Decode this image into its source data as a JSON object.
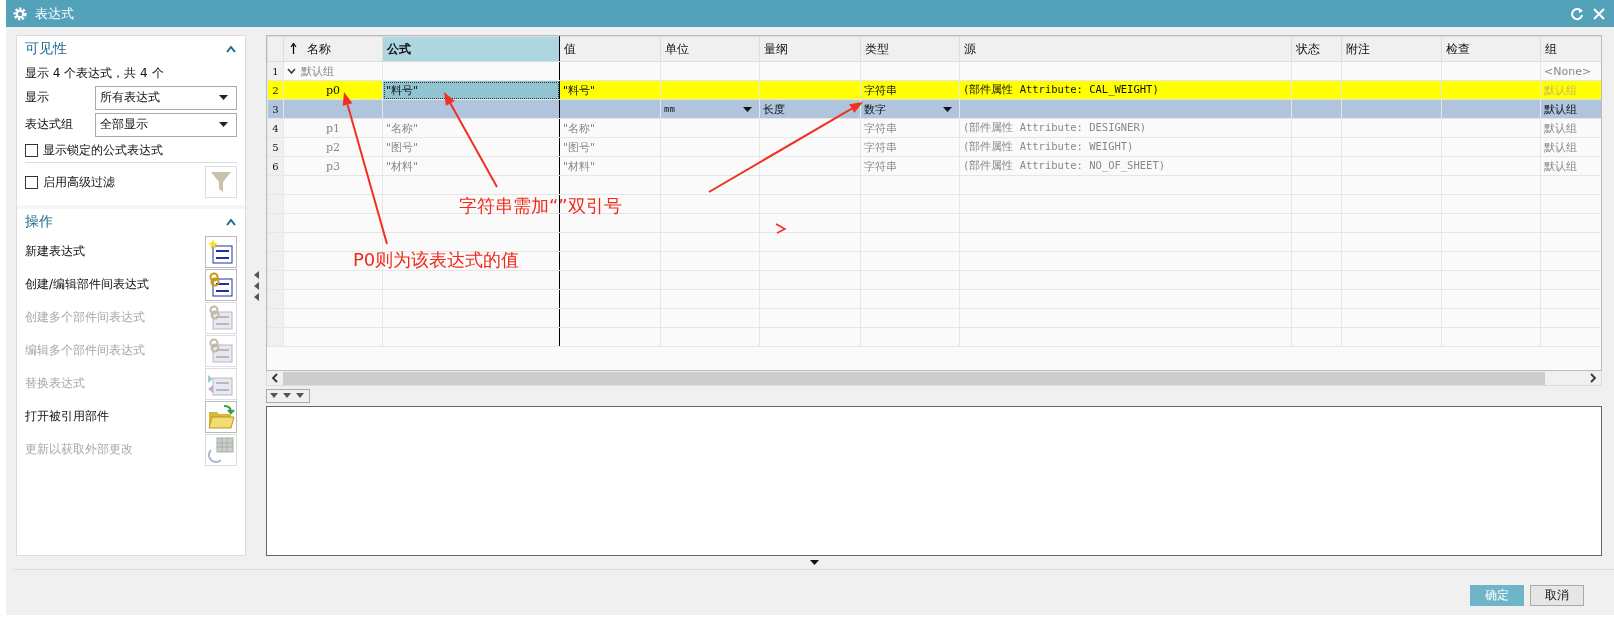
{
  "window": {
    "title": "表达式"
  },
  "visibility": {
    "title": "可见性",
    "expanded": true,
    "summary": "显示 4 个表达式，共 4 个",
    "fields": [
      {
        "label": "显示",
        "value": "所有表达式"
      },
      {
        "label": "表达式组",
        "value": "全部显示"
      }
    ],
    "checkboxes": [
      {
        "label": "显示锁定的公式表达式",
        "checked": false
      },
      {
        "label": "启用高级过滤",
        "checked": false
      }
    ]
  },
  "actions": {
    "title": "操作",
    "expanded": true,
    "items": [
      {
        "label": "新建表达式",
        "disabled": false,
        "kind": "new"
      },
      {
        "label": "创建/编辑部件间表达式",
        "disabled": false,
        "kind": "link"
      },
      {
        "label": "创建多个部件间表达式",
        "disabled": true,
        "kind": "link"
      },
      {
        "label": "编辑多个部件间表达式",
        "disabled": true,
        "kind": "link"
      },
      {
        "label": "替换表达式",
        "disabled": true,
        "kind": "replace"
      },
      {
        "label": "打开被引用部件",
        "disabled": false,
        "kind": "folder"
      },
      {
        "label": "更新以获取外部更改",
        "disabled": true,
        "kind": "update"
      }
    ]
  },
  "table": {
    "columns": [
      {
        "label": "名称",
        "selected": false,
        "sorted": true
      },
      {
        "label": "公式",
        "selected": true,
        "sorted": false
      },
      {
        "label": "值",
        "selected": false,
        "sorted": false
      },
      {
        "label": "单位",
        "selected": false,
        "sorted": false
      },
      {
        "label": "量纲",
        "selected": false,
        "sorted": false
      },
      {
        "label": "类型",
        "selected": false,
        "sorted": false
      },
      {
        "label": "源",
        "selected": false,
        "sorted": false
      },
      {
        "label": "状态",
        "selected": false,
        "sorted": false
      },
      {
        "label": "附注",
        "selected": false,
        "sorted": false
      },
      {
        "label": "检查",
        "selected": false,
        "sorted": false
      },
      {
        "label": "组",
        "selected": false,
        "sorted": false
      }
    ],
    "rows": [
      {
        "number": "1",
        "kind": "group",
        "expanded": true,
        "highlighted": false,
        "dimmed": true,
        "name": "默认组",
        "group": "<None>"
      },
      {
        "number": "2",
        "kind": "expression",
        "highlighted": true,
        "dimmed": false,
        "name": "p0",
        "formula": "\"料号\"",
        "value": "\"料号\"",
        "type": "字符串",
        "source": "(部件属性 Attribute: CAL_WEIGHT)",
        "group": "默认组"
      },
      {
        "number": "3",
        "kind": "edit",
        "highlighted": false,
        "dimmed": false,
        "unit": "mm",
        "dimension": "长度",
        "type": "数字",
        "group": "默认组"
      },
      {
        "number": "4",
        "kind": "expression",
        "highlighted": false,
        "dimmed": true,
        "name": "p1",
        "formula": "\"名称\"",
        "value": "\"名称\"",
        "type": "字符串",
        "source": "(部件属性 Attribute: DESIGNER)",
        "group": "默认组"
      },
      {
        "number": "5",
        "kind": "expression",
        "highlighted": false,
        "dimmed": true,
        "name": "p2",
        "formula": "\"图号\"",
        "value": "\"图号\"",
        "type": "字符串",
        "source": "(部件属性 Attribute: WEIGHT)",
        "group": "默认组"
      },
      {
        "number": "6",
        "kind": "expression",
        "highlighted": false,
        "dimmed": true,
        "name": "p3",
        "formula": "\"材料\"",
        "value": "\"材料\"",
        "type": "字符串",
        "source": "(部件属性 Attribute: NO_OF_SHEET)",
        "group": "默认组"
      }
    ]
  },
  "annotations": [
    {
      "text": "字符串需加“”双引号"
    },
    {
      "text": "P0则为该表达式的值"
    }
  ],
  "buttons": [
    {
      "label": "确定",
      "kind": "primary"
    },
    {
      "label": "取消",
      "kind": "secondary"
    }
  ]
}
